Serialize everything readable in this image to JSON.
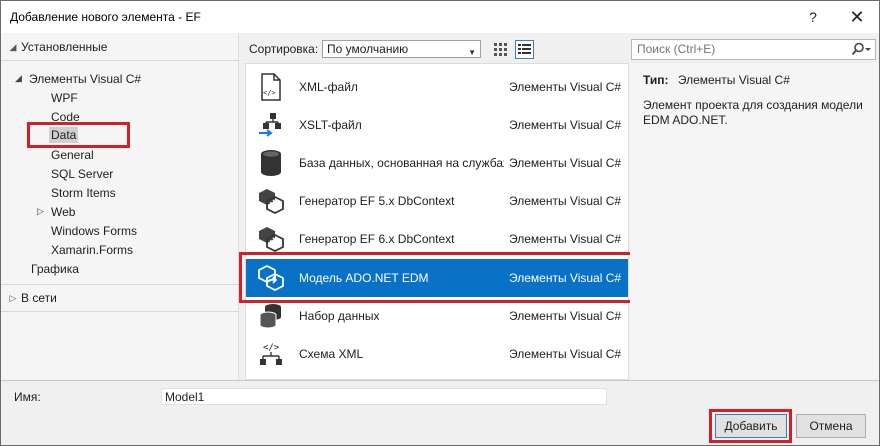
{
  "window": {
    "title": "Добавление нового элемента  - EF",
    "help_glyph": "?",
    "close_glyph": "✕"
  },
  "left_pane": {
    "installed_header": "Установленные",
    "tree": {
      "root_label": "Элементы Visual C#",
      "children": [
        "WPF",
        "Code",
        "Data",
        "General",
        "SQL Server",
        "Storm Items",
        "Web",
        "Windows Forms",
        "Xamarin.Forms"
      ],
      "selected": "Data",
      "graphics_label": "Графика"
    },
    "online_header": "В сети"
  },
  "toolbar": {
    "sort_label": "Сортировка:",
    "sort_value": "По умолчанию",
    "search_placeholder": "Поиск (Ctrl+E)"
  },
  "list": {
    "items": [
      {
        "name": "XML-файл",
        "category": "Элементы Visual C#",
        "icon": "xml-file-icon"
      },
      {
        "name": "XSLT-файл",
        "category": "Элементы Visual C#",
        "icon": "xslt-file-icon"
      },
      {
        "name": "База данных, основанная на службах",
        "category": "Элементы Visual C#",
        "icon": "database-icon"
      },
      {
        "name": "Генератор EF 5.x DbContext",
        "category": "Элементы Visual C#",
        "icon": "ef-generator-icon"
      },
      {
        "name": "Генератор EF 6.x DbContext",
        "category": "Элементы Visual C#",
        "icon": "ef-generator-icon"
      },
      {
        "name": "Модель ADO.NET EDM",
        "category": "Элементы Visual C#",
        "icon": "edm-model-icon"
      },
      {
        "name": "Набор данных",
        "category": "Элементы Visual C#",
        "icon": "dataset-icon"
      },
      {
        "name": "Схема XML",
        "category": "Элементы Visual C#",
        "icon": "xml-schema-icon"
      }
    ],
    "selected_index": 5
  },
  "details": {
    "type_key": "Тип:",
    "type_value": "Элементы Visual C#",
    "description": "Элемент проекта для создания модели EDM ADO.NET."
  },
  "bottom": {
    "name_label": "Имя:",
    "name_value": "Model1",
    "add_label": "Добавить",
    "cancel_label": "Отмена"
  },
  "colors": {
    "selection_blue": "#0a72c6",
    "highlight_red": "#d2202a"
  }
}
